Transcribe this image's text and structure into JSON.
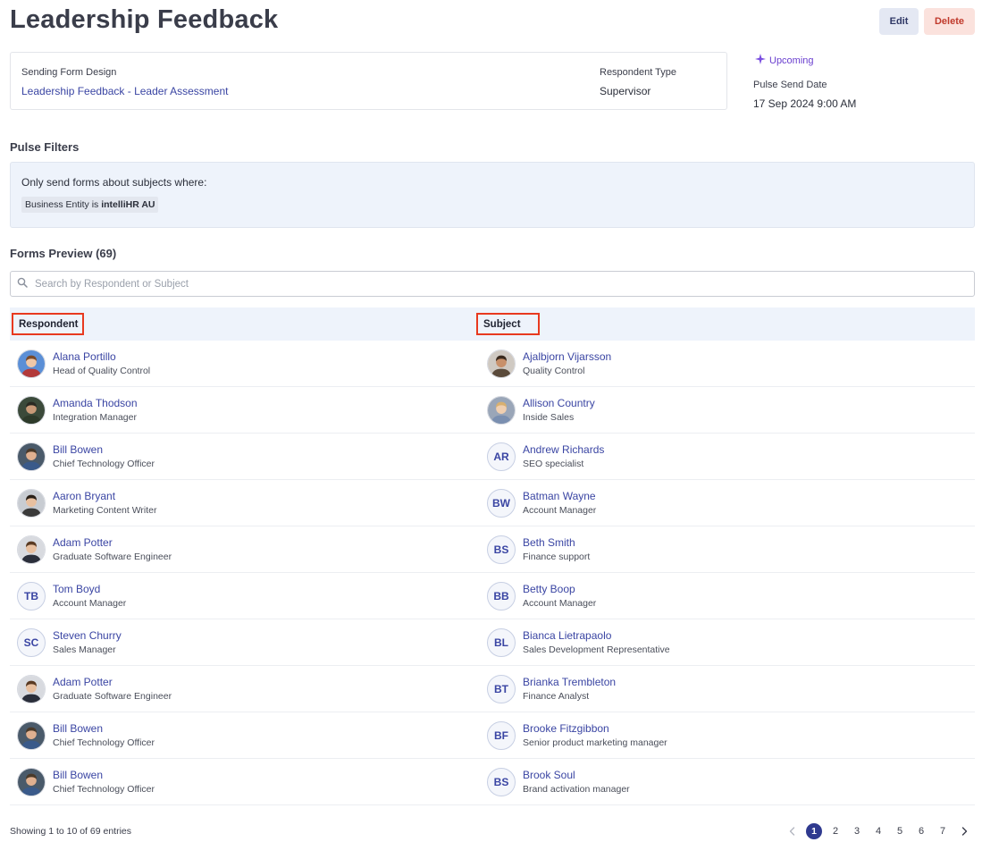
{
  "page": {
    "title": "Leadership Feedback",
    "edit_label": "Edit",
    "delete_label": "Delete"
  },
  "summary": {
    "form_label": "Sending Form Design",
    "form_value": "Leadership Feedback - Leader Assessment",
    "respondent_type_label": "Respondent Type",
    "respondent_type_value": "Supervisor",
    "status": "Upcoming",
    "status_icon": "sparkle-icon",
    "send_date_label": "Pulse Send Date",
    "send_date_value": "17 Sep 2024 9:00 AM"
  },
  "filters": {
    "title": "Pulse Filters",
    "intro": "Only send forms about subjects where:",
    "chip_prefix": "Business Entity is ",
    "chip_value": "intelliHR AU"
  },
  "preview": {
    "title": "Forms Preview (69)",
    "search_placeholder": "Search by Respondent or Subject",
    "columns": [
      "Respondent",
      "Subject"
    ],
    "rows": [
      {
        "resp": {
          "name": "Alana Portillo",
          "title": "Head of Quality Control",
          "avatar": "photo",
          "skin": "#f0c8a8",
          "hair": "#7a4a2a",
          "shirt": "#b33a3a",
          "bg": "#5b8fd6"
        },
        "subj": {
          "name": "Ajalbjorn Vijarsson",
          "title": "Quality Control",
          "avatar": "photo",
          "skin": "#c8906a",
          "hair": "#3a2a1e",
          "shirt": "#5a4a3a",
          "bg": "#cfc9c2"
        }
      },
      {
        "resp": {
          "name": "Amanda Thodson",
          "title": "Integration Manager",
          "avatar": "photo",
          "skin": "#c89a78",
          "hair": "#2a2a22",
          "shirt": "#2d3a2a",
          "bg": "#3b4a3a"
        },
        "subj": {
          "name": "Allison Country",
          "title": "Inside Sales",
          "avatar": "photo",
          "skin": "#f0cfb0",
          "hair": "#d8b070",
          "shirt": "#7a8fb0",
          "bg": "#9aa6b8"
        }
      },
      {
        "resp": {
          "name": "Bill Bowen",
          "title": "Chief Technology Officer",
          "avatar": "photo",
          "skin": "#e0b090",
          "hair": "#4a3a2a",
          "shirt": "#3a5a8a",
          "bg": "#4a5a6a"
        },
        "subj": {
          "name": "Andrew Richards",
          "title": "SEO specialist",
          "avatar": "initials",
          "initials": "AR"
        }
      },
      {
        "resp": {
          "name": "Aaron Bryant",
          "title": "Marketing Content Writer",
          "avatar": "photo",
          "skin": "#e8c0a0",
          "hair": "#2a2018",
          "shirt": "#3a3a3a",
          "bg": "#c8ccd2"
        },
        "subj": {
          "name": "Batman Wayne",
          "title": "Account Manager",
          "avatar": "initials",
          "initials": "BW"
        }
      },
      {
        "resp": {
          "name": "Adam Potter",
          "title": "Graduate Software Engineer",
          "avatar": "photo",
          "skin": "#e8c0a0",
          "hair": "#5a3a22",
          "shirt": "#2a2e3a",
          "bg": "#d8dadf"
        },
        "subj": {
          "name": "Beth Smith",
          "title": "Finance support",
          "avatar": "initials",
          "initials": "BS"
        }
      },
      {
        "resp": {
          "name": "Tom Boyd",
          "title": "Account Manager",
          "avatar": "initials",
          "initials": "TB"
        },
        "subj": {
          "name": "Betty Boop",
          "title": "Account Manager",
          "avatar": "initials",
          "initials": "BB"
        }
      },
      {
        "resp": {
          "name": "Steven Churry",
          "title": "Sales Manager",
          "avatar": "initials",
          "initials": "SC"
        },
        "subj": {
          "name": "Bianca Lietrapaolo",
          "title": "Sales Development Representative",
          "avatar": "initials",
          "initials": "BL"
        }
      },
      {
        "resp": {
          "name": "Adam Potter",
          "title": "Graduate Software Engineer",
          "avatar": "photo",
          "skin": "#e8c0a0",
          "hair": "#5a3a22",
          "shirt": "#2a2e3a",
          "bg": "#d8dadf"
        },
        "subj": {
          "name": "Brianka Trembleton",
          "title": "Finance Analyst",
          "avatar": "initials",
          "initials": "BT"
        }
      },
      {
        "resp": {
          "name": "Bill Bowen",
          "title": "Chief Technology Officer",
          "avatar": "photo",
          "skin": "#e0b090",
          "hair": "#4a3a2a",
          "shirt": "#3a5a8a",
          "bg": "#4a5a6a"
        },
        "subj": {
          "name": "Brooke Fitzgibbon",
          "title": "Senior product marketing manager",
          "avatar": "initials",
          "initials": "BF"
        }
      },
      {
        "resp": {
          "name": "Bill Bowen",
          "title": "Chief Technology Officer",
          "avatar": "photo",
          "skin": "#e0b090",
          "hair": "#4a3a2a",
          "shirt": "#3a5a8a",
          "bg": "#4a5a6a"
        },
        "subj": {
          "name": "Brook Soul",
          "title": "Brand activation manager",
          "avatar": "initials",
          "initials": "BS"
        }
      }
    ]
  },
  "footer": {
    "showing": "Showing 1 to 10 of 69 entries",
    "pages": [
      "1",
      "2",
      "3",
      "4",
      "5",
      "6",
      "7"
    ],
    "active_page": "1"
  }
}
